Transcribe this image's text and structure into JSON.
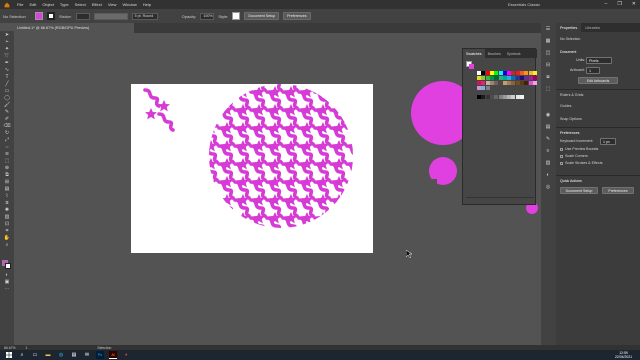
{
  "menubar": {
    "app_logo": "Ai",
    "items": [
      "File",
      "Edit",
      "Object",
      "Type",
      "Select",
      "Effect",
      "View",
      "Window",
      "Help"
    ],
    "workspace": "Essentials Classic",
    "window_controls": [
      "–",
      "❐",
      "✕"
    ]
  },
  "controlbar": {
    "selection_label": "No Selection",
    "stroke_label": "Stroke:",
    "brush_value": "5 pt. Round",
    "opacity_label": "Opacity:",
    "opacity_value": "100%",
    "style_label": "Style:",
    "document_setup": "Document Setup",
    "preferences": "Preferences"
  },
  "document": {
    "tab_title": "Untitled-1* @ 66.67% (RGB/GPU Preview)"
  },
  "swatches_panel": {
    "tabs": [
      "Swatches",
      "Brushes",
      "Symbols"
    ],
    "colors": {
      "row1": [
        "#ffffff",
        "#000000",
        "#ff0000",
        "#ffff00",
        "#00ff00",
        "#00ffff",
        "#0000ff",
        "#ff00ff",
        "#c1272d",
        "#ed1c24",
        "#f15a24",
        "#f7931e",
        "#fbb03b",
        "#fcee21"
      ],
      "row2": [
        "#d9e021",
        "#8cc63f",
        "#39b54a",
        "#009245",
        "#006837",
        "#22b573",
        "#00a99d",
        "#29abe2",
        "#0071bc",
        "#2e3192",
        "#1b1464",
        "#662d91",
        "#93278f",
        "#9e005d"
      ],
      "row3": [
        "#d4145a",
        "#ed1e79",
        "#c7b299",
        "#998675",
        "#736357",
        "#534741",
        "#c69c6d",
        "#a67c52",
        "#8c6239",
        "#754c24",
        "#603813",
        "#42210b",
        "#e84dde",
        "#f2a0ec"
      ],
      "row4": [
        "#c39bd3",
        "#7fb3d5",
        "#808080"
      ],
      "grays": [
        "#000000",
        "#1a1a1a",
        "#333333",
        "#4d4d4d",
        "#666666",
        "#808080",
        "#999999",
        "#b3b3b3",
        "#cccccc",
        "#e6e6e6",
        "#f2f2f2"
      ]
    }
  },
  "properties_panel": {
    "tabs": [
      "Properties",
      "Libraries"
    ],
    "no_selection": "No Selection",
    "document_label": "Document",
    "units_label": "Units:",
    "units_value": "Pixels",
    "artboard_label": "Artboard:",
    "artboard_value": "1",
    "edit_artboards": "Edit Artboards",
    "rulers_grids": "Rulers & Grids",
    "guides": "Guides",
    "snap_options": "Snap Options",
    "preferences_heading": "Preferences",
    "keyboard_increment_label": "Keyboard Increment:",
    "keyboard_increment_value": "1 px",
    "use_preview_bounds": "Use Preview Bounds",
    "scale_corners": "Scale Corners",
    "scale_strokes": "Scale Strokes & Effects",
    "quick_actions": "Quick Actions",
    "document_setup": "Document Setup",
    "preferences": "Preferences"
  },
  "statusbar": {
    "zoom": "66.67%",
    "artboard": "1",
    "tool": "Selection"
  },
  "taskbar": {
    "time": "12:59",
    "date": "22/04/2021"
  },
  "colors": {
    "accent_magenta": "#e040e0",
    "canvas_bg": "#535353",
    "artboard": "#ffffff"
  }
}
